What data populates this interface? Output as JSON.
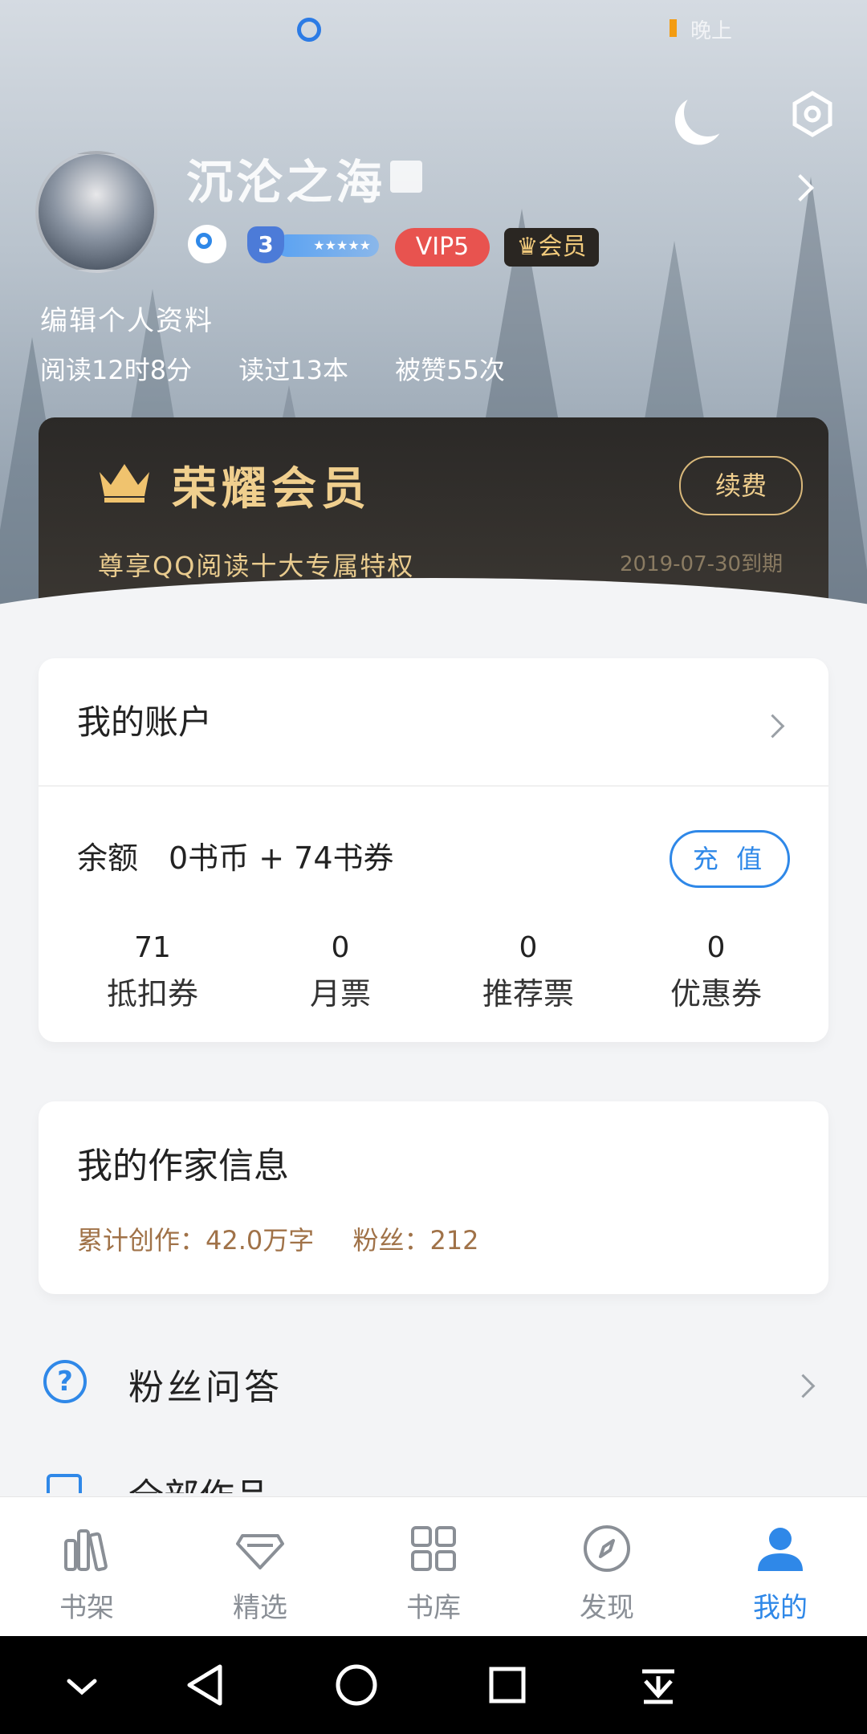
{
  "status_bar": {
    "right_text": "晚上"
  },
  "profile": {
    "nickname": "沉沦之海",
    "level": "3",
    "vip": "VIP5",
    "member_badge": "会员",
    "edit_label": "编辑个人资料",
    "stats": [
      "阅读12时8分",
      "读过13本",
      "被赞55次"
    ]
  },
  "vip_card": {
    "title": "荣耀会员",
    "subtitle": "尊享QQ阅读十大专属特权",
    "renew_label": "续费",
    "expire": "2019-07-30到期"
  },
  "account": {
    "title": "我的账户",
    "balance": "余额　0书币 + 74书券",
    "recharge_label": "充 值",
    "tickets": [
      {
        "value": "71",
        "label": "抵扣券"
      },
      {
        "value": "0",
        "label": "月票"
      },
      {
        "value": "0",
        "label": "推荐票"
      },
      {
        "value": "0",
        "label": "优惠券"
      }
    ]
  },
  "author": {
    "title": "我的作家信息",
    "words": "累计创作：42.0万字",
    "fans": "粉丝：212"
  },
  "menu": {
    "qa": "粉丝问答",
    "works": "全部作品"
  },
  "tabs": [
    {
      "label": "书架",
      "icon": "bookshelf-icon"
    },
    {
      "label": "精选",
      "icon": "diamond-icon"
    },
    {
      "label": "书库",
      "icon": "grid-icon"
    },
    {
      "label": "发现",
      "icon": "compass-icon"
    },
    {
      "label": "我的",
      "icon": "user-icon"
    }
  ],
  "colors": {
    "accent": "#2f88e8",
    "vip_gold": "#f0cf8e",
    "vip_red": "#e8534f"
  }
}
